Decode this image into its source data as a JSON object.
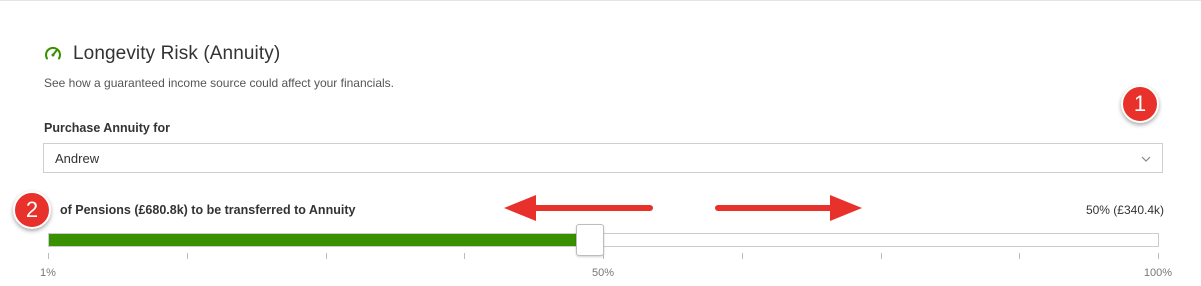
{
  "header": {
    "icon": "speedometer-icon",
    "icon_color": "#3a9100",
    "title": "Longevity Risk (Annuity)",
    "subtitle": "See how a guaranteed income source could affect your financials."
  },
  "purchase": {
    "label": "Purchase Annuity for",
    "selected": "Andrew"
  },
  "slider": {
    "label": "of Pensions (£680.8k) to be transferred to Annuity",
    "value_text": "50% (£340.4k)",
    "percent": 50,
    "min_label": "1%",
    "mid_label": "50%",
    "max_label": "100%",
    "fill_color": "#3a9100"
  },
  "annotations": {
    "badge_1": "1",
    "badge_2": "2",
    "accent_color": "#e8312a"
  }
}
